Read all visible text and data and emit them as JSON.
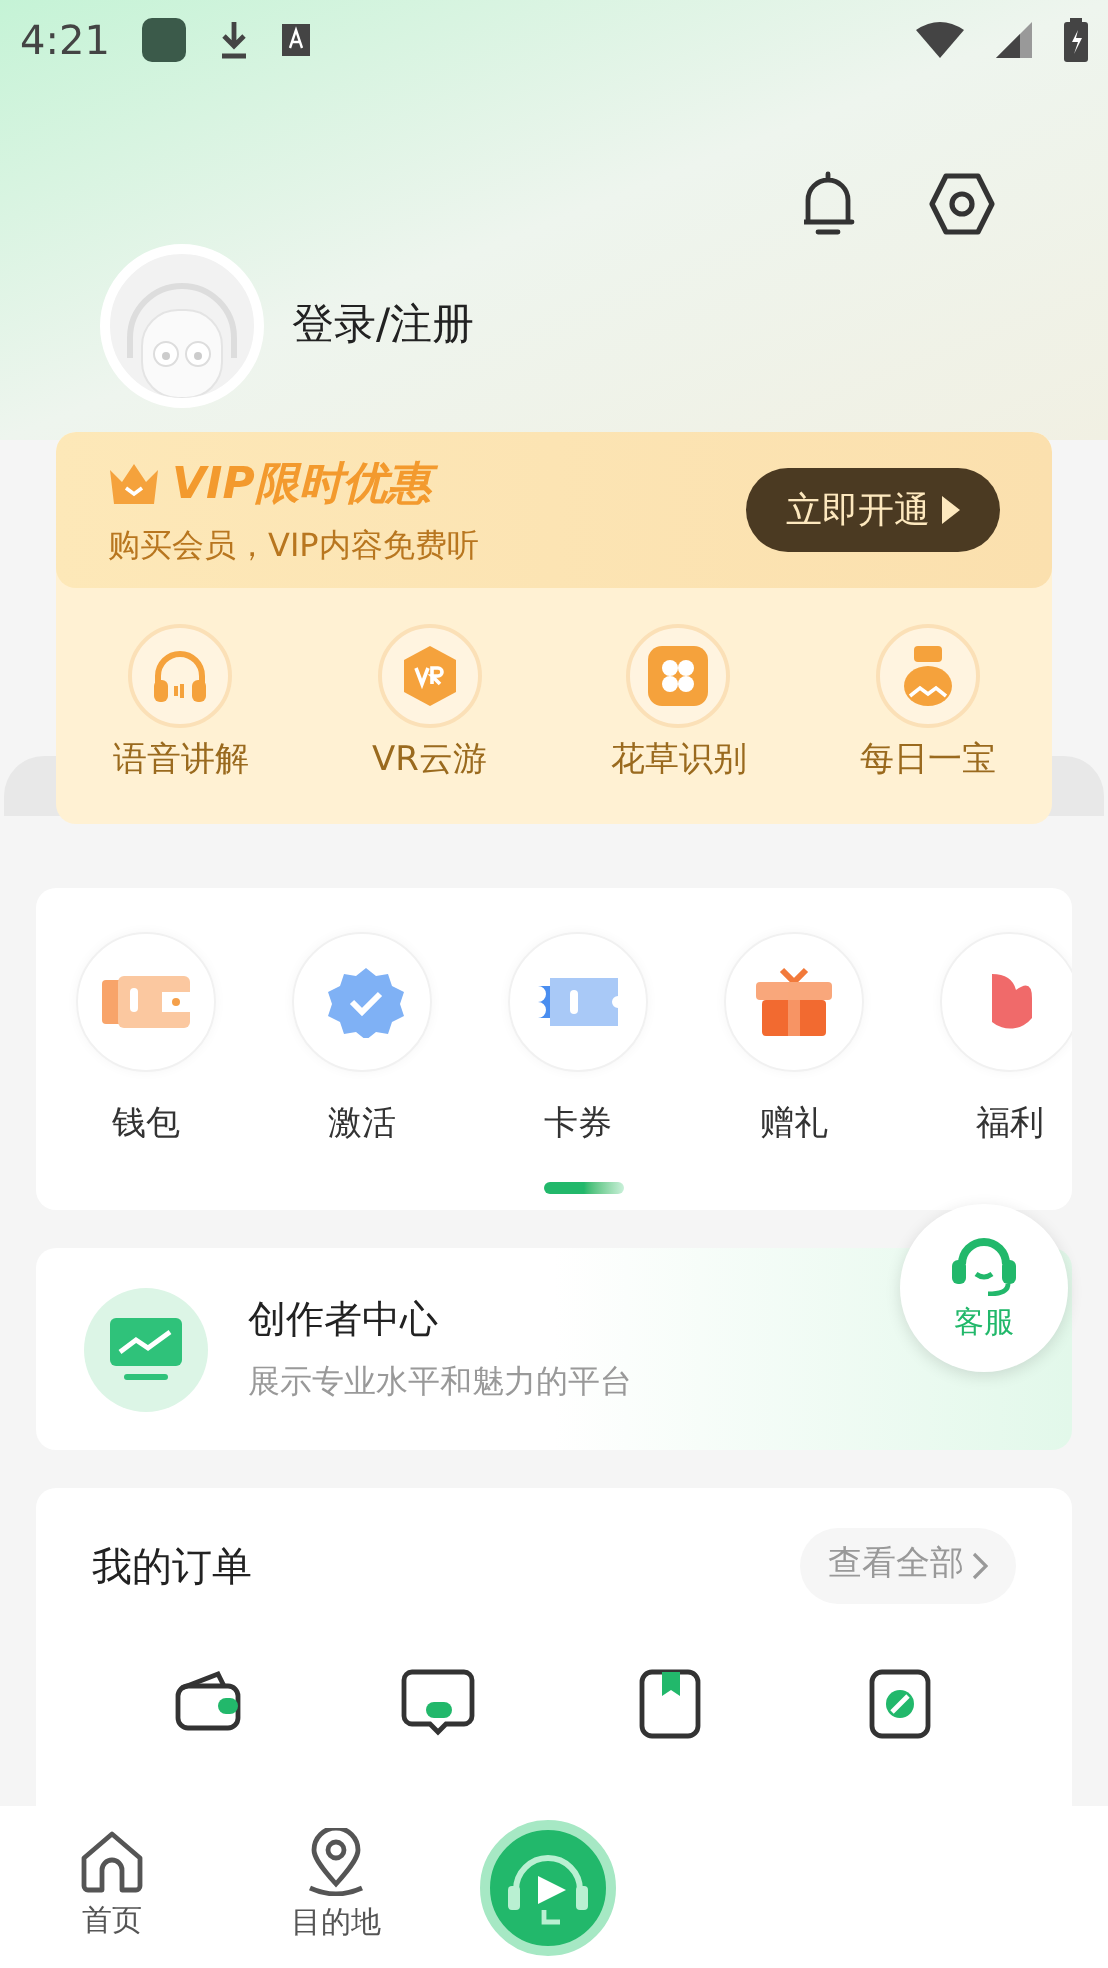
{
  "status_bar": {
    "time": "4:21"
  },
  "profile": {
    "login_label": "登录/注册"
  },
  "vip": {
    "title": "VIP限时优惠",
    "subtitle": "购买会员，VIP内容免费听",
    "button": "立即开通"
  },
  "vip_features": [
    {
      "kind": "headphones",
      "label": "语音讲解"
    },
    {
      "kind": "vr",
      "label": "VR云游"
    },
    {
      "kind": "flower",
      "label": "花草识别"
    },
    {
      "kind": "treasure",
      "label": "每日一宝"
    }
  ],
  "services": [
    {
      "kind": "wallet",
      "label": "钱包"
    },
    {
      "kind": "badge",
      "label": "激活"
    },
    {
      "kind": "ticket",
      "label": "卡券"
    },
    {
      "kind": "gift",
      "label": "赠礼"
    },
    {
      "kind": "bonus",
      "label": "福利"
    }
  ],
  "creator": {
    "title": "创作者中心",
    "subtitle": "展示专业水平和魅力的平台"
  },
  "support": {
    "label": "客服"
  },
  "orders": {
    "title": "我的订单",
    "view_all": "查看全部",
    "items": [
      {
        "kind": "wallet"
      },
      {
        "kind": "comment"
      },
      {
        "kind": "book"
      },
      {
        "kind": "cancel"
      }
    ]
  },
  "bottom_nav": [
    {
      "kind": "home",
      "label": "首页",
      "selected": false
    },
    {
      "kind": "pin",
      "label": "目的地",
      "selected": false
    },
    {
      "kind": "play",
      "selected": false
    }
  ]
}
